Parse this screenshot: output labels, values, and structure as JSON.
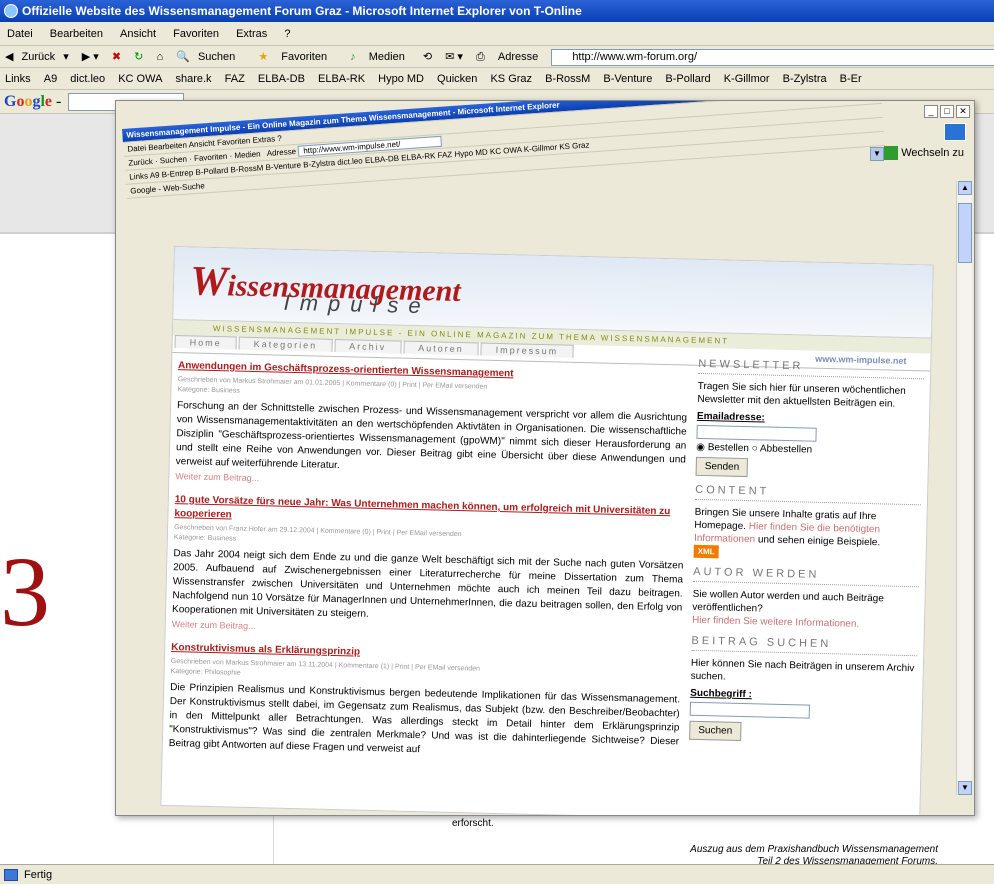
{
  "outer": {
    "title": "Offizielle Website des Wissensmanagement Forum Graz - Microsoft Internet Explorer von T-Online",
    "menu": [
      "Datei",
      "Bearbeiten",
      "Ansicht",
      "Favoriten",
      "Extras",
      "?"
    ],
    "toolbar": {
      "back": "Zurück",
      "search": "Suchen",
      "favorites": "Favoriten",
      "media": "Medien",
      "address_label": "Adresse",
      "address": "http://www.wm-forum.org/"
    },
    "links_label": "Links",
    "links": [
      "A9",
      "dict.leo",
      "KC OWA",
      "share.k",
      "FAZ",
      "ELBA-DB",
      "ELBA-RK",
      "Hypo MD",
      "Quicken",
      "KS Graz",
      "B-RossM",
      "B-Venture",
      "B-Pollard",
      "K-Gillmor",
      "B-Zylstra",
      "B-Er"
    ],
    "google": {
      "g1": "G",
      "o1": "o",
      "o2": "o",
      "g2": "g",
      "l": "l",
      "e": "e",
      "dash": " -"
    },
    "status": "Fertig",
    "big_number": "3",
    "erforscht": "erforscht.",
    "footer_line1": "Auszug aus dem Praxishandbuch Wissensmanagement",
    "footer_line2": "Teil 2 des Wissensmanagement Forums."
  },
  "inner": {
    "title": "Wissensmanagement Impulse - Ein Online Magazin zum Thema Wissensmanagement - Microsoft Internet Explorer",
    "menu": "Datei Bearbeiten Ansicht Favoriten Extras ?",
    "toolbar": "Zurück · Suchen · Favoriten · Medien",
    "address_label": "Adresse",
    "address": "http://www.wm-impulse.net/",
    "links": "Links A9 B-Entrep B-Pollard B-RossM B-Venture B-Zylstra dict.leo ELBA-DB ELBA-RK FAZ Hypo MD KC OWA K-Gillmor KS Graz",
    "google": "Google - Web-Suche",
    "wechseln": "Wechseln zu"
  },
  "site": {
    "logo_w": "W",
    "logo_rest": "issensmanagement",
    "impulse": "Impulse",
    "tagline": "WISSENSMANAGEMENT IMPULSE - EIN ONLINE MAGAZIN ZUM THEMA WISSENSMANAGEMENT",
    "tabs": [
      "Home",
      "Kategorien",
      "Archiv",
      "Autoren",
      "Impressum"
    ],
    "url": "www.wm-impulse.net"
  },
  "articles": [
    {
      "title": "Anwendungen im Geschäftsprozess-orientierten Wissensmanagement",
      "meta": "Geschrieben von Markus Strohmaier am 01.01.2005 | Kommentare (0) | Print | Per EMail versenden",
      "category": "Kategorie: Business",
      "body": "Forschung an der Schnittstelle zwischen Prozess- und Wissensmanagement verspricht vor allem die Ausrichtung von Wissensmanagementaktivitäten an den wertschöpfenden Aktivtäten in Organisationen. Die wissenschaftliche Disziplin \"Geschäftsprozess-orientiertes Wissensmanagement (gpoWM)\" nimmt sich dieser Herausforderung an und stellt eine Reihe von Anwendungen vor. Dieser Beitrag gibt eine Übersicht über diese Anwendungen und verweist auf weiterführende Literatur.",
      "more": "Weiter zum Beitrag..."
    },
    {
      "title": "10 gute Vorsätze fürs neue Jahr: Was Unternehmen machen können, um erfolgreich mit Universitäten zu kooperieren",
      "meta": "Geschrieben von Franz Hofer am 29.12.2004 | Kommentare (0) | Print | Per EMail versenden",
      "category": "Kategorie: Business",
      "body": "Das Jahr 2004 neigt sich dem Ende zu und die ganze Welt beschäftigt sich mit der Suche nach guten Vorsätzen 2005. Aufbauend auf Zwischenergebnissen einer Literaturrecherche für meine Dissertation zum Thema Wissenstransfer zwischen Universitäten und Unternehmen möchte auch ich meinen Teil dazu beitragen. Nachfolgend nun 10 Vorsätze für ManagerInnen und UnternehmerInnen, die dazu beitragen sollen, den Erfolg von Kooperationen mit Universitäten zu steigern.",
      "more": "Weiter zum Beitrag..."
    },
    {
      "title": "Konstruktivismus als Erklärungsprinzip",
      "meta": "Geschrieben von Markus Strohmaier am 13.11.2004 | Kommentare (1) | Print | Per EMail versenden",
      "category": "Kategorie: Philosophie",
      "body": "Die Prinzipien Realismus und Konstruktivismus bergen bedeutende Implikationen für das Wissensmanagement. Der Konstruktivismus stellt dabei, im Gegensatz zum Realismus, das Subjekt (bzw. den Beschreiber/Beobachter) in den Mittelpunkt aller Betrachtungen. Was allerdings steckt im Detail hinter dem Erklärungsprinzip \"Konstruktivismus\"? Was sind die zentralen Merkmale? Und was ist die dahinterliegende Sichtweise? Dieser Beitrag gibt Antworten auf diese Fragen und verweist auf",
      "more": ""
    }
  ],
  "sidebar": {
    "newsletter_head": "NEWSLETTER",
    "newsletter_text": "Tragen Sie sich hier für unseren wöchentlichen Newsletter mit den aktuellsten Beiträgen ein.",
    "email_label": "Emailadresse:",
    "opt_subscribe": "Bestellen",
    "opt_unsubscribe": "Abbestellen",
    "send": "Senden",
    "content_head": "CONTENT",
    "content_text1": "Bringen Sie unsere Inhalte gratis auf Ihre Homepage.",
    "content_link": "Hier finden Sie die benötigten Informationen",
    "content_text2": "und sehen einige Beispiele.",
    "xml": "XML",
    "author_head": "AUTOR WERDEN",
    "author_text": "Sie wollen Autor werden und auch Beiträge veröffentlichen?",
    "author_link": "Hier finden Sie weitere Informationen.",
    "search_head": "BEITRAG SUCHEN",
    "search_text": "Hier können Sie nach Beiträgen in unserem Archiv suchen.",
    "search_label": "Suchbegriff :",
    "search_button": "Suchen"
  }
}
